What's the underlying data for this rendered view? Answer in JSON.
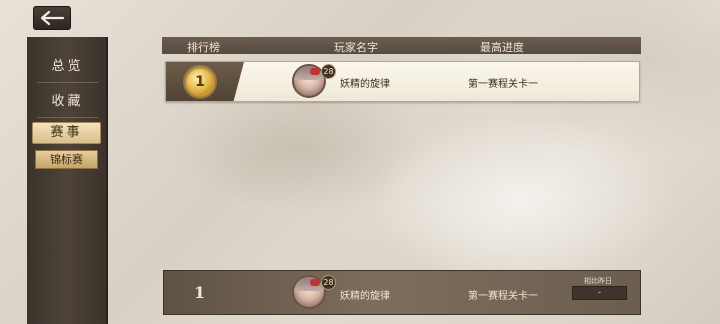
{
  "nav": {
    "back_icon": "back-arrow-icon"
  },
  "sidebar": {
    "items": [
      {
        "label": "总览"
      },
      {
        "label": "收藏"
      },
      {
        "label": "赛事"
      }
    ],
    "sub_item": {
      "label": "锦标赛"
    }
  },
  "table": {
    "headers": [
      "排行榜",
      "玩家名字",
      "最高进度"
    ]
  },
  "top_entry": {
    "rank": "1",
    "level": "28",
    "player_name": "妖精的旋律",
    "progress": "第一赛程关卡一"
  },
  "my_entry": {
    "rank": "1",
    "level": "28",
    "player_name": "妖精的旋律",
    "progress": "第一赛程关卡一",
    "compare_label": "相比昨日",
    "compare_value": "-"
  },
  "colors": {
    "sidebar": "#4d433a",
    "header": "#5f5447",
    "active_tab": "#e8d3a3",
    "medal": "#e3b445"
  }
}
